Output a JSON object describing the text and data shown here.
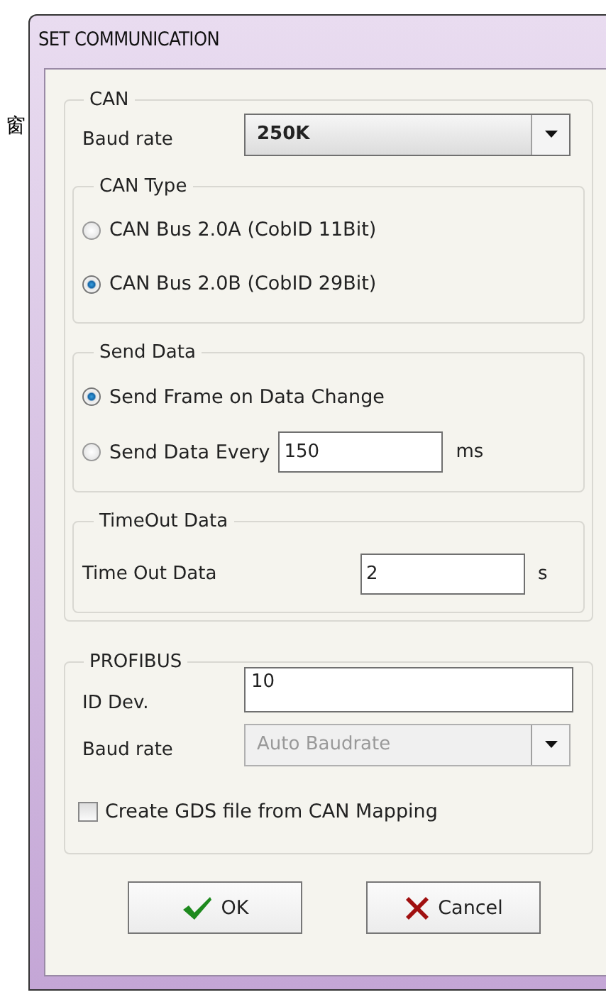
{
  "background_text": "窗",
  "window": {
    "title": "SET COMMUNICATION"
  },
  "can": {
    "title": "CAN",
    "baud_rate": {
      "label": "Baud rate",
      "value": "250K",
      "disabled": false
    },
    "can_type": {
      "title": "CAN Type",
      "options": [
        {
          "label": "CAN Bus 2.0A (CobID 11Bit)",
          "selected": false
        },
        {
          "label": "CAN Bus 2.0B (CobID 29Bit)",
          "selected": true
        }
      ]
    },
    "send_data": {
      "title": "Send Data",
      "options": [
        {
          "kind": "plain",
          "label": "Send Frame on Data Change",
          "selected": true
        },
        {
          "kind": "interval",
          "label": "Send Data Every",
          "value": "150",
          "unit": "ms",
          "selected": false
        }
      ]
    },
    "timeout": {
      "title": "TimeOut Data",
      "label": "Time Out Data",
      "value": "2",
      "unit": "s"
    }
  },
  "profibus": {
    "title": "PROFIBUS",
    "id_dev": {
      "label": "ID Dev.",
      "value": "10"
    },
    "baud_rate": {
      "label": "Baud rate",
      "value": "Auto Baudrate",
      "disabled": true
    },
    "gds": {
      "label": "Create GDS file from CAN Mapping",
      "checked": false
    }
  },
  "buttons": [
    {
      "kind": "ok",
      "label": "OK"
    },
    {
      "kind": "cancel",
      "label": "Cancel"
    }
  ]
}
